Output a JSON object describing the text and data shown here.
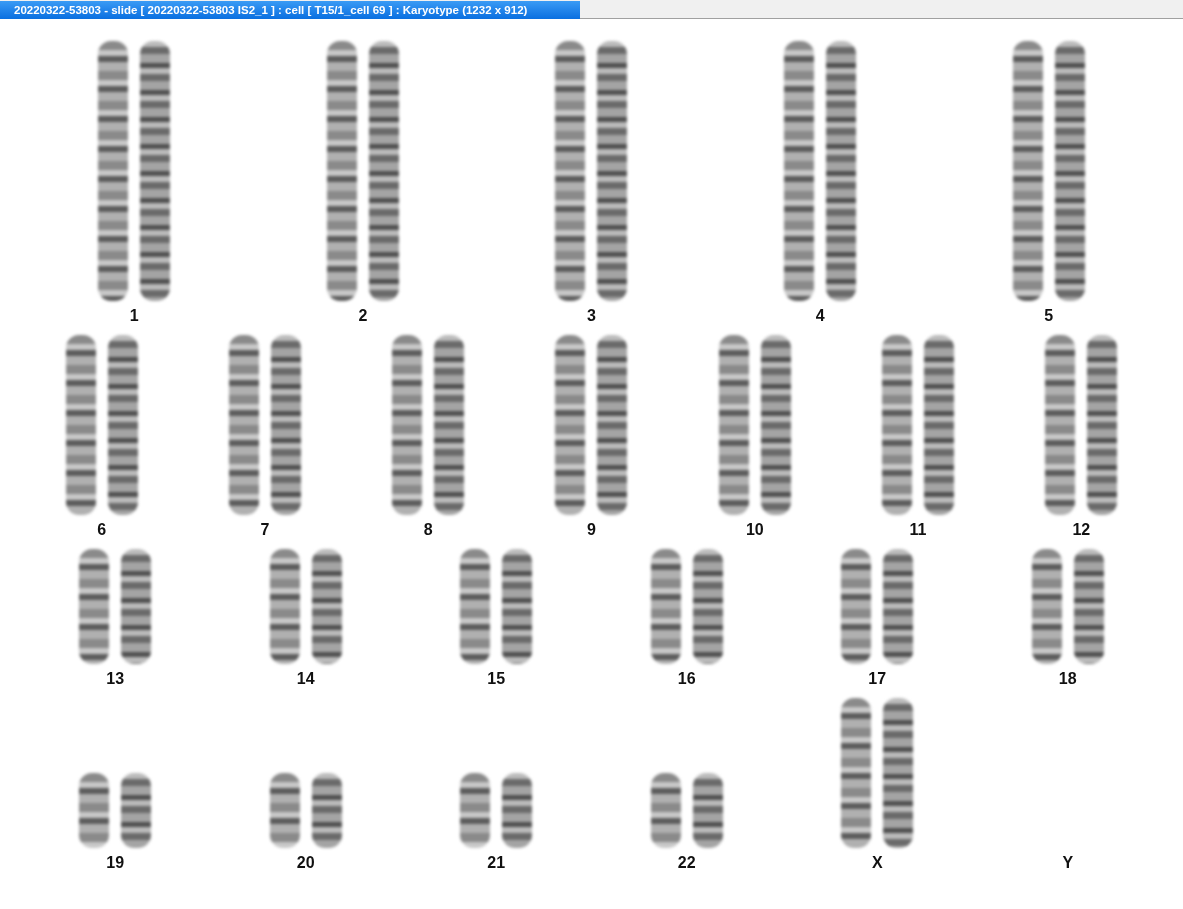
{
  "window": {
    "title": "20220322-53803 - slide [ 20220322-53803 IS2_1 ] : cell [ T15/1_cell 69 ] : Karyotype  (1232 x 912)"
  },
  "karyotype": {
    "rows": [
      {
        "groups": [
          {
            "label": "1",
            "kind": "large"
          },
          {
            "label": "2",
            "kind": "large"
          },
          {
            "label": "3",
            "kind": "large"
          },
          {
            "label": "4",
            "kind": "large"
          },
          {
            "label": "5",
            "kind": "large"
          }
        ]
      },
      {
        "groups": [
          {
            "label": "6",
            "kind": "large"
          },
          {
            "label": "7",
            "kind": "large"
          },
          {
            "label": "8",
            "kind": "large"
          },
          {
            "label": "9",
            "kind": "large"
          },
          {
            "label": "10",
            "kind": "large"
          },
          {
            "label": "11",
            "kind": "large"
          },
          {
            "label": "12",
            "kind": "large"
          }
        ]
      },
      {
        "groups": [
          {
            "label": "13",
            "kind": "large"
          },
          {
            "label": "14",
            "kind": "large"
          },
          {
            "label": "15",
            "kind": "large"
          },
          {
            "label": "16",
            "kind": "large"
          },
          {
            "label": "17",
            "kind": "large"
          },
          {
            "label": "18",
            "kind": "large"
          }
        ]
      },
      {
        "groups": [
          {
            "label": "19",
            "kind": "small"
          },
          {
            "label": "20",
            "kind": "small"
          },
          {
            "label": "21",
            "kind": "small"
          },
          {
            "label": "22",
            "kind": "small"
          },
          {
            "label": "X",
            "kind": "large"
          },
          {
            "label": "Y",
            "kind": "empty"
          }
        ]
      }
    ]
  }
}
